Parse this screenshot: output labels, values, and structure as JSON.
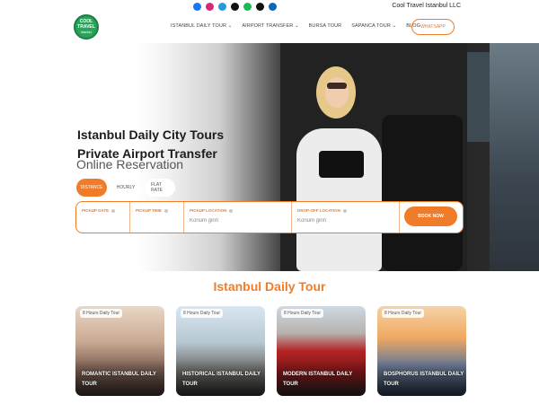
{
  "topbar": {
    "social_icons": [
      {
        "name": "facebook-icon",
        "color": "#1877f2"
      },
      {
        "name": "instagram-icon",
        "color": "#d62976"
      },
      {
        "name": "telegram-icon",
        "color": "#229ed9"
      },
      {
        "name": "tiktok-icon",
        "color": "#111111"
      },
      {
        "name": "spotify-icon",
        "color": "#1db954"
      },
      {
        "name": "x-icon",
        "color": "#111111"
      },
      {
        "name": "linkedin-icon",
        "color": "#0a66c2"
      }
    ],
    "company": "Cool Travel Istanbul LLC"
  },
  "header": {
    "logo_lines": [
      "COOL",
      "TRAVEL",
      "Istanbul"
    ],
    "nav": [
      "ISTANBUL DAILY TOUR",
      "AIRPORT TRANSFER",
      "BURSA TOUR",
      "SAPANCA TOUR",
      "BLOG"
    ],
    "nav_dropdown": [
      "⌄",
      "⌄",
      "",
      "⌄",
      ""
    ],
    "whatsapp": "WHATSAPP"
  },
  "hero": {
    "title_line1": "Istanbul Daily City Tours",
    "title_line2": "Private Airport Transfer"
  },
  "reservation": {
    "title": "Online Reservation",
    "tabs": [
      "DISTANCE",
      "HOURLY",
      "FLAT RATE"
    ],
    "fields": {
      "pickup_date": "PICKUP DATE",
      "pickup_time": "PICKUP TIME",
      "pickup_location": "PICKUP LOCATION",
      "pickup_location_placeholder": "Konum girin",
      "dropoff_location": "DROP-OFF LOCATION",
      "dropoff_location_placeholder": "Konum girin"
    },
    "book_now": "BOOK NOW"
  },
  "tours": {
    "title": "Istanbul Daily Tour",
    "cards": [
      {
        "tag": "8 Hours Daily Tour",
        "title": "ROMANTIC ISTANBUL DAILY TOUR"
      },
      {
        "tag": "8 Hours Daily Tour",
        "title": "HISTORICAL ISTANBUL DAILY TOUR"
      },
      {
        "tag": "8 Hours Daily Tour",
        "title": "MODERN ISTANBUL DAILY TOUR"
      },
      {
        "tag": "8 Hours Daily Tour",
        "title": "BOSPHORUS ISTANBUL DAILY TOUR"
      }
    ]
  },
  "colors": {
    "accent": "#f07c2a",
    "brand_green": "#2aa35a"
  }
}
